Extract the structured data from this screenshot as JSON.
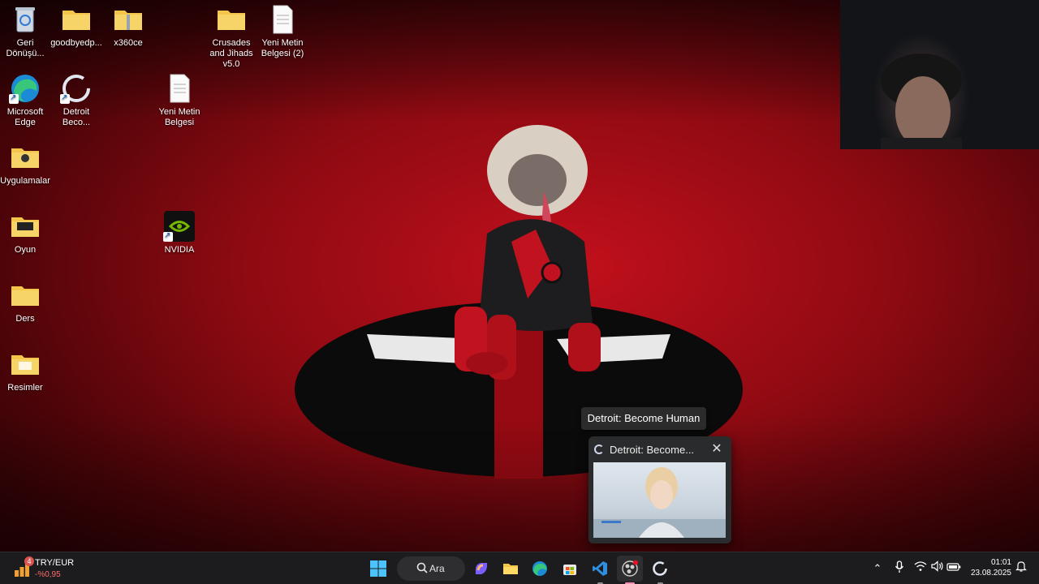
{
  "desktop": {
    "icons": [
      {
        "label": "Geri Dönüşü...",
        "icon": "recycle-bin-icon"
      },
      {
        "label": "goodbyedp...",
        "icon": "folder-icon"
      },
      {
        "label": "x360ce",
        "icon": "zip-folder-icon"
      },
      {
        "label": "Crusades and Jihads v5.0",
        "icon": "folder-icon"
      },
      {
        "label": "Yeni Metin Belgesi (2)",
        "icon": "text-document-icon"
      },
      {
        "label": "Microsoft Edge",
        "icon": "edge-icon"
      },
      {
        "label": "Detroit Beco...",
        "icon": "detroit-app-icon"
      },
      {
        "label": "Yeni Metin Belgesi",
        "icon": "text-document-icon"
      },
      {
        "label": "Uygulamalar",
        "icon": "folder-icon"
      },
      {
        "label": "Oyun",
        "icon": "folder-icon"
      },
      {
        "label": "NVIDIA",
        "icon": "nvidia-icon"
      },
      {
        "label": "Ders",
        "icon": "folder-icon"
      },
      {
        "label": "Resimler",
        "icon": "folder-icon"
      }
    ]
  },
  "tooltip": {
    "text": "Detroit: Become Human"
  },
  "thumbnail": {
    "title": "Detroit: Become...",
    "close_icon": "close-icon"
  },
  "taskbar": {
    "widget": {
      "badge": "4",
      "symbol": "TRY/EUR",
      "change": "-%0,95",
      "change_color": "#ff6b6b"
    },
    "search_label": "Ara",
    "apps": [
      "start-icon",
      "copilot-icon",
      "file-explorer-icon",
      "edge-icon",
      "store-icon",
      "vscode-icon",
      "obs-icon",
      "detroit-app-icon"
    ],
    "tray": [
      "chevron-up-icon",
      "microphone-icon",
      "wifi-icon",
      "speaker-icon",
      "battery-icon"
    ],
    "clock": {
      "time": "01:01",
      "date": "23.08.2025"
    },
    "notification_icon": "notification-bell-icon"
  },
  "colors": {
    "wallpaper_red": "#c2101c",
    "taskbar": "#1c1c1e",
    "accent_pink": "#f48fb1"
  }
}
